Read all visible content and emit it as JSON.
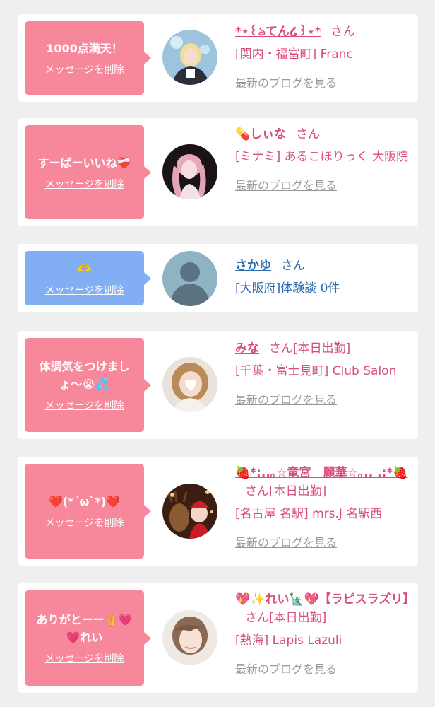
{
  "delete_label": "メッセージを削除",
  "blog_label": "最新のブログを見る",
  "honorific": "さん",
  "colors": {
    "pink_bubble": "#f7889b",
    "blue_bubble": "#82aef3",
    "pink_text": "#d94e78",
    "blue_text": "#2a6db0",
    "link_gray": "#999999"
  },
  "cards": [
    {
      "message": "1000点満天！",
      "name": "*⋆꒰ঌてん໒꒱⋆*",
      "status": "",
      "shop": "[関内・福富町] Franc",
      "avatar": "avatar-photo-blonde"
    },
    {
      "message": "すーぱーいいね❤️‍🩹",
      "name": "💊しぃな",
      "status": "",
      "shop": "[ミナミ] あるこほりっく 大阪院",
      "avatar": "avatar-photo-pink-hair"
    },
    {
      "message": "🫶",
      "name": "さかゆ",
      "status": "",
      "shop": "[大阪府]体験談 0件",
      "avatar": "no-photo-silhouette"
    },
    {
      "message": "体調気をつけましょ〜😭💦",
      "name": "みな",
      "status": "[本日出勤]",
      "shop": "[千葉・富士見町] Club Salon",
      "avatar": "avatar-photo-heart-face"
    },
    {
      "message": "❤️(*´ω`*)❤️",
      "name": "🍓*:..｡☆竜宮　麗華☆｡.. .:*🍓",
      "status": "[本日出勤]",
      "shop": "[名古屋 名駅] mrs.J 名駅西",
      "avatar": "avatar-photo-reindeer"
    },
    {
      "message": "ありがとーー👌💗💗れい",
      "name": "💖✨れい🗽💖【ラピスラズリ】",
      "status": "[本日出勤]",
      "shop": "[熱海] Lapis Lazuli",
      "avatar": "avatar-photo-portrait"
    }
  ]
}
